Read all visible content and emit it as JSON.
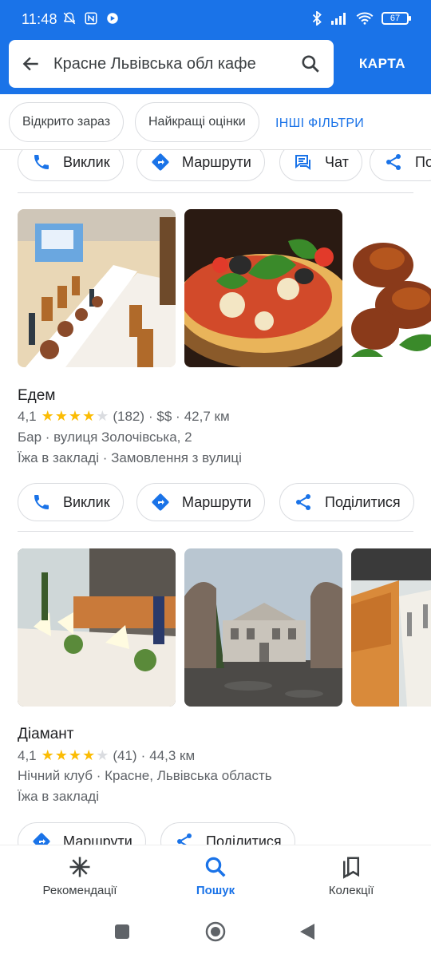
{
  "status": {
    "time": "11:48",
    "battery": "67"
  },
  "search": {
    "query": "Красне Львівська обл кафе",
    "map_label": "КАРТА"
  },
  "filters": {
    "chips": [
      "Відкрито зараз",
      "Найкращі оцінки"
    ],
    "more": "ІНШІ ФІЛЬТРИ"
  },
  "top_actions": {
    "call": "Виклик",
    "route": "Маршрути",
    "chat": "Чат",
    "share": "По"
  },
  "places": [
    {
      "name": "Едем",
      "rating": "4,1",
      "stars": 4,
      "reviews": "(182)",
      "price": "· $$ ·",
      "distance": "42,7 км",
      "details": "Бар · вулиця Золочівська, 2",
      "services": "Їжа в закладі · Замовлення з вулиці",
      "actions": {
        "call": "Виклик",
        "route": "Маршрути",
        "share": "Поділитися"
      }
    },
    {
      "name": "Діамант",
      "rating": "4,1",
      "stars": 4,
      "reviews": "(41)",
      "price": "·",
      "distance": "44,3 км",
      "details": "Нічний клуб · Красне, Львівська область",
      "services": "Їжа в закладі",
      "actions": {
        "route": "Маршрути",
        "share": "Поділитися"
      }
    }
  ],
  "bottom_nav": {
    "explore": "Рекомендації",
    "search": "Пошук",
    "saved": "Колекції"
  },
  "colors": {
    "accent": "#1a73e8",
    "star": "#fbbc04"
  }
}
